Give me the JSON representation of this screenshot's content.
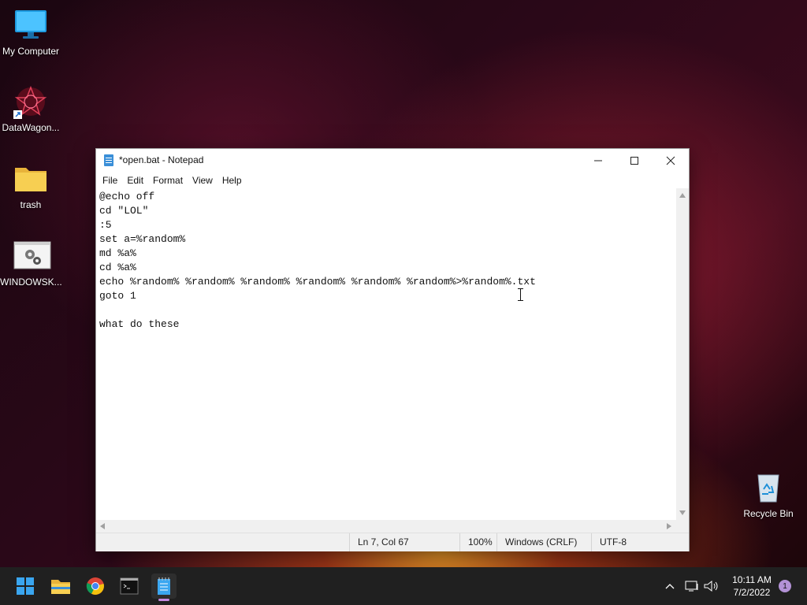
{
  "desktop": {
    "icons": [
      {
        "label": "My Computer",
        "icon": "monitor-icon"
      },
      {
        "label": "DataWagon...",
        "icon": "datawagon-icon"
      },
      {
        "label": "trash",
        "icon": "folder-icon"
      },
      {
        "label": "WINDOWSK...",
        "icon": "settings-app-icon"
      },
      {
        "label": "Recycle Bin",
        "icon": "recycle-bin-icon"
      }
    ]
  },
  "notepad": {
    "title": "*open.bat - Notepad",
    "menu": [
      "File",
      "Edit",
      "Format",
      "View",
      "Help"
    ],
    "content": "@echo off\ncd \"LOL\"\n:5\nset a=%random%\nmd %a%\ncd %a%\necho %random% %random% %random% %random% %random% %random%>%random%.txt\ngoto 1\n\nwhat do these",
    "status": {
      "position": "Ln 7, Col 67",
      "zoom": "100%",
      "line_ending": "Windows (CRLF)",
      "encoding": "UTF-8"
    }
  },
  "taskbar": {
    "apps": [
      "start-icon",
      "file-explorer-icon",
      "chrome-icon",
      "terminal-icon",
      "notepad-icon"
    ],
    "time": "10:11 AM",
    "date": "7/2/2022",
    "notification_count": "1"
  },
  "colors": {
    "taskbar_bg": "#202020",
    "accent": "#3a8fd8",
    "notification_badge": "#b392d6"
  }
}
